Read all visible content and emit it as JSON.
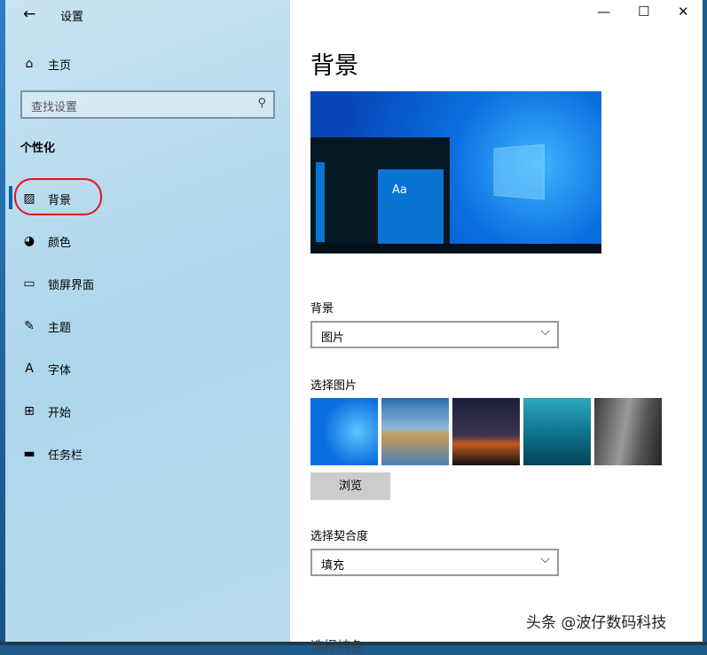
{
  "window": {
    "title": "设置",
    "back": "←",
    "minimize": "—",
    "maximize": "☐",
    "close": "✕"
  },
  "sidebar": {
    "home": "主页",
    "search_placeholder": "查找设置",
    "section": "个性化",
    "items": [
      {
        "label": "背景",
        "icon": "picture-icon"
      },
      {
        "label": "颜色",
        "icon": "palette-icon"
      },
      {
        "label": "锁屏界面",
        "icon": "lockscreen-icon"
      },
      {
        "label": "主题",
        "icon": "theme-icon"
      },
      {
        "label": "字体",
        "icon": "font-icon"
      },
      {
        "label": "开始",
        "icon": "start-icon"
      },
      {
        "label": "任务栏",
        "icon": "taskbar-icon"
      }
    ]
  },
  "main": {
    "heading": "背景",
    "preview_text": "Aa",
    "background_label": "背景",
    "background_value": "图片",
    "choose_picture_label": "选择图片",
    "browse": "浏览",
    "fit_label": "选择契合度",
    "fit_value": "填充",
    "cut_label": "选择纯色"
  },
  "watermark": "头条 @波仔数码科技",
  "colors": {
    "accent": "#0063b1",
    "annotation": "#e0141e"
  }
}
